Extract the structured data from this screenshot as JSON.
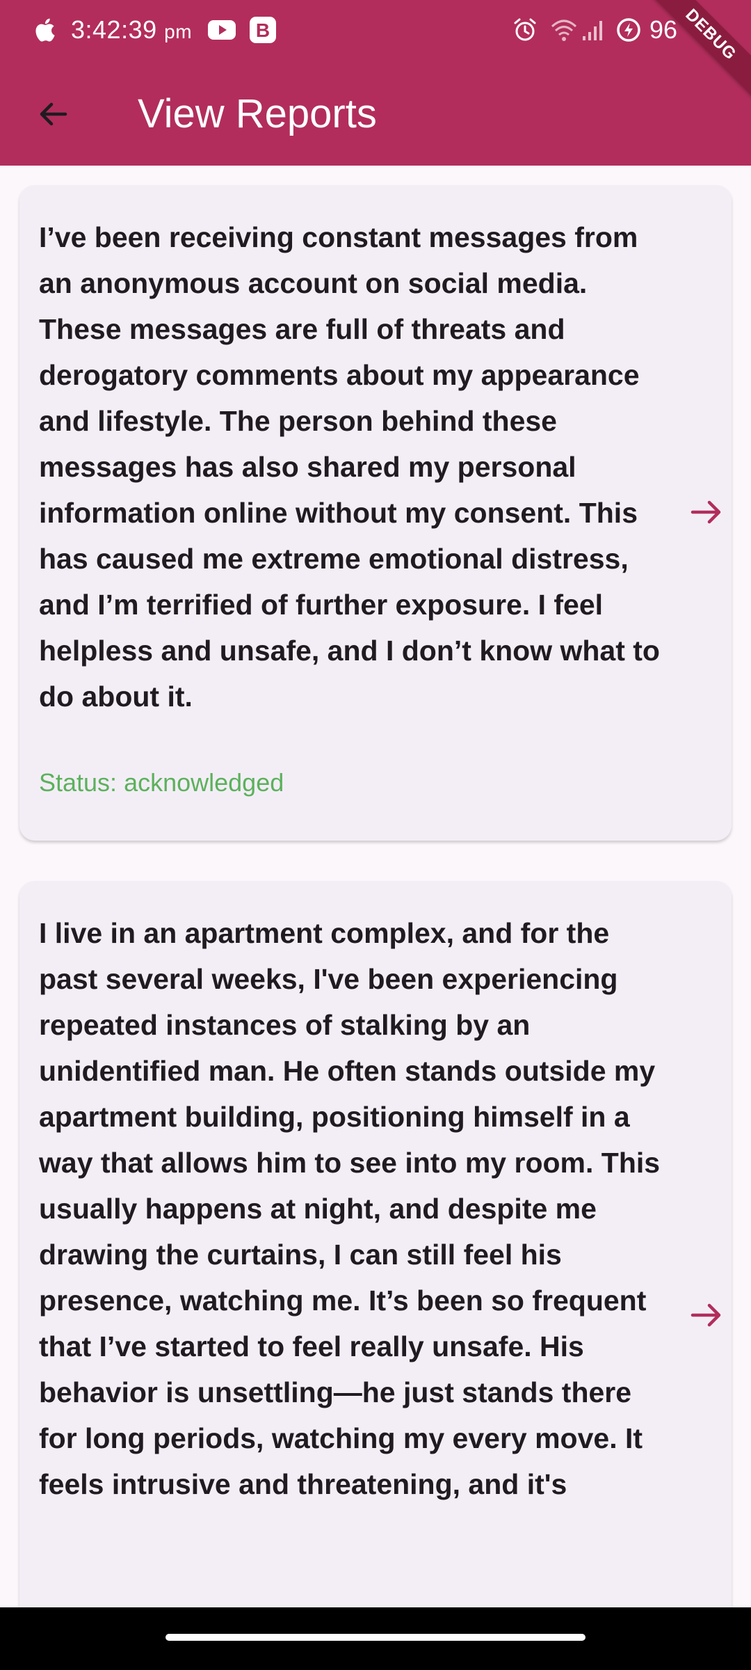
{
  "status_bar": {
    "time": "3:42:39",
    "ampm": "pm",
    "battery": "96",
    "icons": [
      "apple-icon",
      "youtube-icon",
      "b-app-icon",
      "alarm-icon",
      "wifi-icon",
      "signal-icon",
      "battery-saver-icon"
    ]
  },
  "debug_banner": "DEBUG",
  "app_bar": {
    "title": "View Reports",
    "back_icon": "arrow-left-icon"
  },
  "reports": [
    {
      "description": "I’ve been receiving constant messages from an anonymous account on social media. These messages are full of threats and derogatory comments about my appearance and lifestyle. The person behind these messages has also shared my personal information online without my consent. This has caused me extreme emotional distress, and I’m terrified of further exposure. I feel helpless and unsafe, and I don’t know what to do about it.",
      "status": "Status: acknowledged",
      "status_color": "#5cb15c"
    },
    {
      "description": "I live in an apartment complex, and for the past several weeks, I've been experiencing repeated instances of stalking by an unidentified man. He often stands outside my apartment building, positioning himself in a way that allows him to see into my room. This usually happens at night, and despite me drawing the curtains, I can still feel his presence, watching me. It’s been so frequent that I’ve started to feel really unsafe. His behavior is unsettling—he just stands there for long periods, watching my every move. It feels intrusive and threatening, and it's"
    }
  ],
  "colors": {
    "primary": "#b22d5b",
    "card_background": "#f3eef6",
    "page_background": "#fcf7fb",
    "status_acknowledged": "#5cb15c"
  }
}
